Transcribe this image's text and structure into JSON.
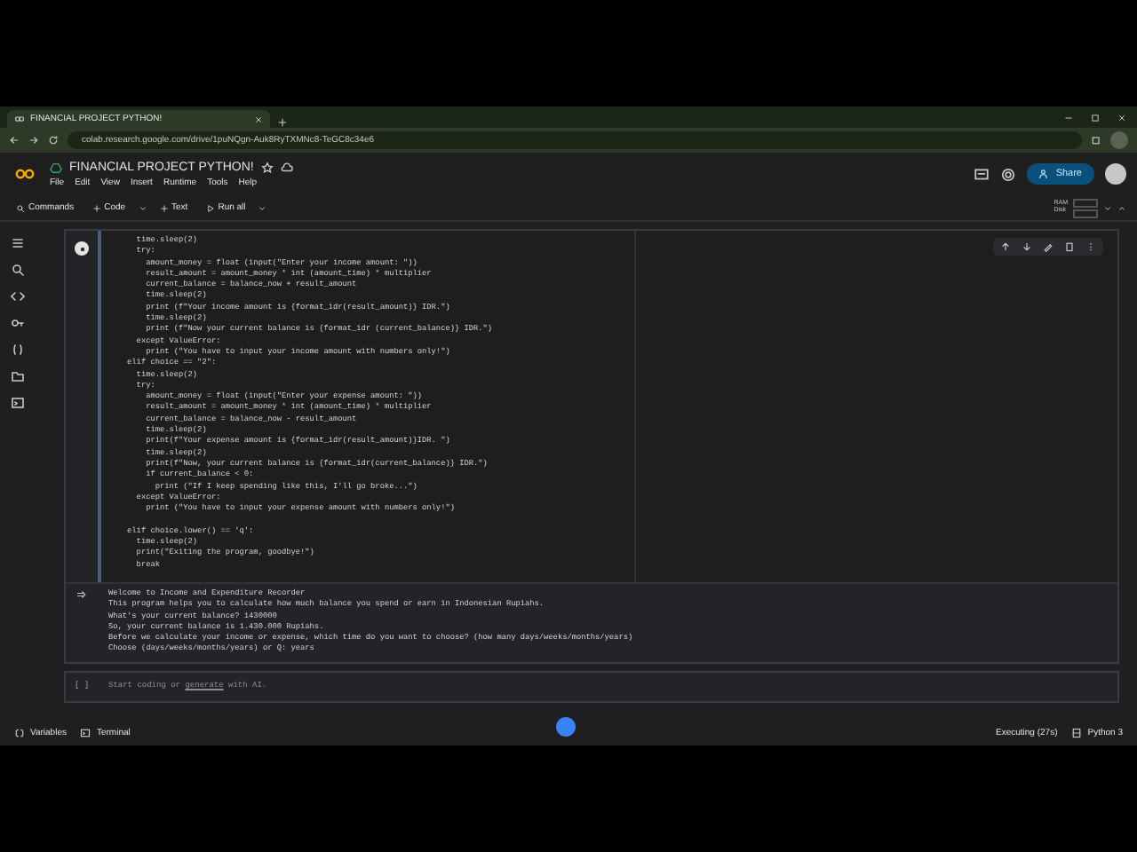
{
  "browser": {
    "tab_title": "FINANCIAL PROJECT PYTHON!",
    "url": "colab.research.google.com/drive/1puNQgn-Auk8RyTXMNc8-TeGC8c34e6"
  },
  "notebook": {
    "title": "FINANCIAL PROJECT PYTHON!",
    "menu": [
      "File",
      "Edit",
      "View",
      "Insert",
      "Runtime",
      "Tools",
      "Help"
    ],
    "share": "Share"
  },
  "toolbar": {
    "commands": "Commands",
    "add_code": "Code",
    "add_text": "Text",
    "run_all": "Run all",
    "ram": "RAM",
    "disk": "Disk"
  },
  "code_cell": {
    "lines": [
      {
        "text": "      time.sleep(2)",
        "gap_before": false
      },
      {
        "text": "      try:",
        "gap_before": false
      },
      {
        "text": "        amount_money = float (input(\"Enter your income amount: \"))",
        "gap_before": false
      },
      {
        "text": "        result_amount = amount_money * int (amount_time) * multiplier",
        "gap_before": false
      },
      {
        "text": "        current_balance = balance_now + result_amount",
        "gap_before": false
      },
      {
        "text": "        time.sleep(2)",
        "gap_before": false
      },
      {
        "text": "        print (f\"Your income amount is {format_idr(result_amount)} IDR.\")",
        "gap_before": false
      },
      {
        "text": "        time.sleep(2)",
        "gap_before": false
      },
      {
        "text": "        print (f\"Now your current balance is {format_idr (current_balance)} IDR.\")",
        "gap_before": false
      },
      {
        "text": "      except ValueError:",
        "gap_before": false
      },
      {
        "text": "        print (\"You have to input your income amount with numbers only!\")",
        "gap_before": false
      },
      {
        "text": "    elif choice == \"2\":",
        "gap_before": false
      },
      {
        "text": "      time.sleep(2)",
        "gap_before": false
      },
      {
        "text": "      try:",
        "gap_before": false
      },
      {
        "text": "        amount_money = float (input(\"Enter your expense amount: \"))",
        "gap_before": false
      },
      {
        "text": "        result_amount = amount_money * int (amount_time) * multiplier",
        "gap_before": false
      },
      {
        "text": "        current_balance = balance_now - result_amount",
        "gap_before": false
      },
      {
        "text": "        time.sleep(2)",
        "gap_before": false
      },
      {
        "text": "        print(f\"Your expense amount is {format_idr(result_amount)}IDR. \")",
        "gap_before": false
      },
      {
        "text": "        time.sleep(2)",
        "gap_before": false
      },
      {
        "text": "        print(f\"Now, your current balance is {format_idr(current_balance)} IDR.\")",
        "gap_before": false
      },
      {
        "text": "        if current_balance < 0:",
        "gap_before": false
      },
      {
        "text": "          print (\"If I keep spending like this, I'll go broke...\")",
        "gap_before": false
      },
      {
        "text": "      except ValueError:",
        "gap_before": false
      },
      {
        "text": "        print (\"You have to input your expense amount with numbers only!\")",
        "gap_before": false
      },
      {
        "text": "    elif choice.lower() == 'q':",
        "gap_before": true
      },
      {
        "text": "      time.sleep(2)",
        "gap_before": false
      },
      {
        "text": "      print(\"Exiting the program, goodbye!\")",
        "gap_before": false
      },
      {
        "text": "      break",
        "gap_before": false
      }
    ],
    "output": [
      "Welcome to Income and Expenditure Recorder",
      "This program helps you to calculate how much balance you spend or earn in Indonesian Rupiahs.",
      "What's your current balance? 1430000",
      "So, your current balance is 1.430.000 Rupiahs.",
      "Before we calculate your income or expense, which time do you want to choose? (how many days/weeks/months/years)",
      "Choose (days/weeks/months/years) or Q: years"
    ]
  },
  "empty_cell": {
    "prompt": "[ ]",
    "placeholder_start": "Start coding or ",
    "placeholder_link": "generate",
    "placeholder_end": " with AI."
  },
  "status_bar": {
    "variables": "Variables",
    "terminal": "Terminal",
    "executing": "Executing (27s)",
    "runtime": "Python 3"
  }
}
